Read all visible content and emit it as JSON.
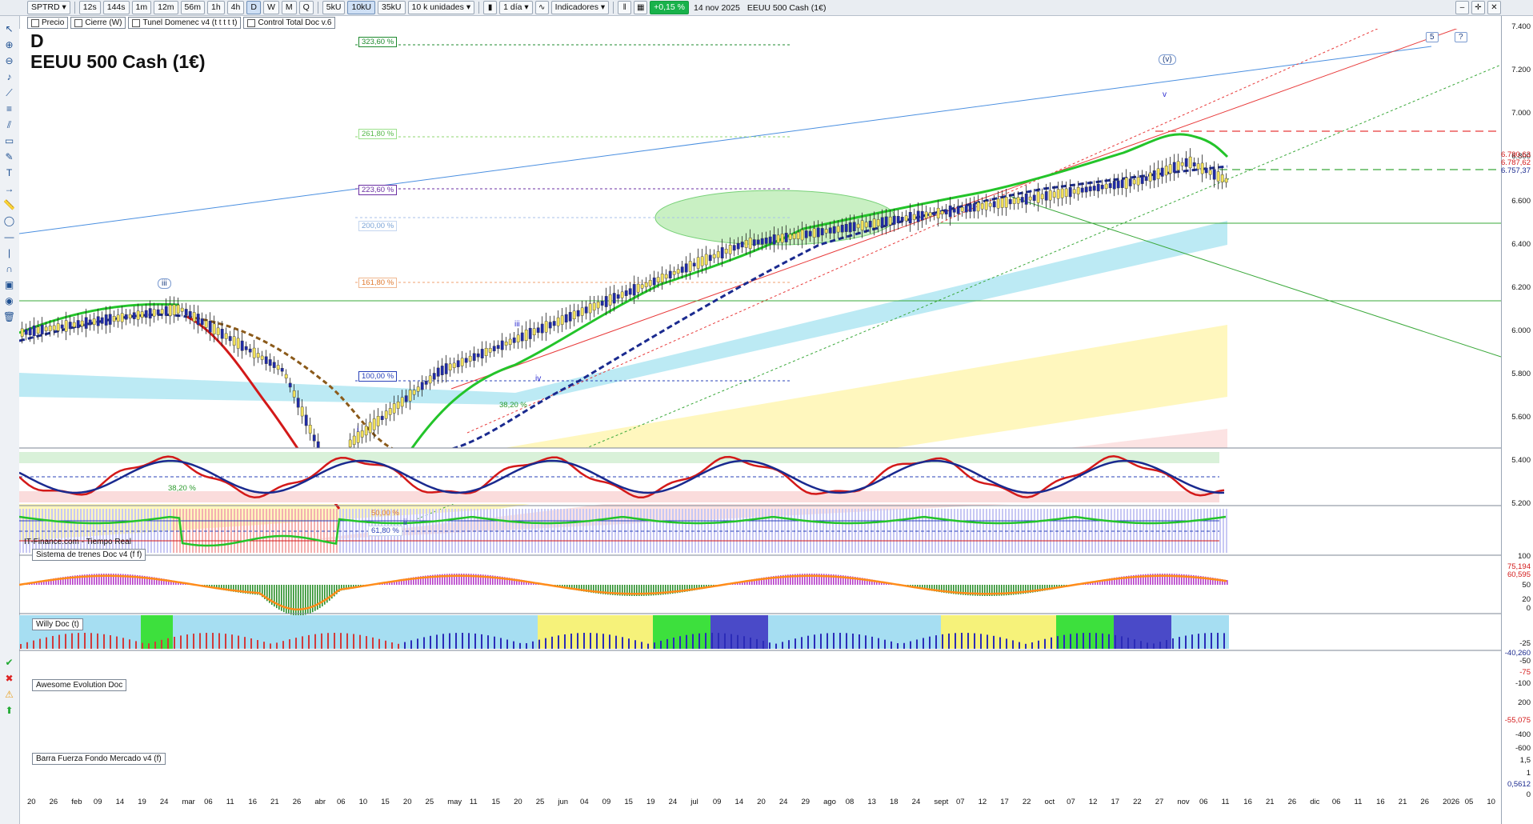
{
  "toolbar": {
    "symbol": "SPTRD",
    "intervals": [
      "12s",
      "144s",
      "1m",
      "12m",
      "56m",
      "1h",
      "4h",
      "D",
      "W",
      "M",
      "Q"
    ],
    "active_interval": "D",
    "volumes": [
      "5kU",
      "10kU",
      "35kU"
    ],
    "active_volume": "10kU",
    "units": "10 k unidades",
    "period": "1 día",
    "indicators_label": "Indicadores",
    "change": "+0,15 %",
    "date": "14 nov 2025",
    "instrument_title": "EEUU 500 Cash (1€)"
  },
  "overlays": [
    "Precio",
    "Cierre (W)",
    "Tunel Domenec v4 (t t t t t)",
    "Control Total Doc v.6"
  ],
  "chart": {
    "timeframe_letter": "D",
    "title": "EEUU 500 Cash (1€)",
    "source": "IT-Finance.com - Tiempo Real",
    "fib_levels": [
      {
        "label": "323,60 %",
        "color": "#1d8a2d"
      },
      {
        "label": "261,80 %",
        "color": "#55b84a"
      },
      {
        "label": "223,60 %",
        "color": "#6b2fa3"
      },
      {
        "label": "200,00 %",
        "color": "#7aa3d6"
      },
      {
        "label": "161,80 %",
        "color": "#e07a30"
      },
      {
        "label": "100,00 %",
        "color": "#2840b8"
      },
      {
        "label": "38,20 %",
        "color": "#2d9a2d"
      },
      {
        "label": "50,00 %",
        "color": "#e07a30"
      },
      {
        "label": "61,80 %",
        "color": "#2840b8"
      },
      {
        "label": "38,20 %",
        "color": "#2d9a2d"
      }
    ],
    "wave_labels": [
      "iii",
      "iii",
      "i",
      "ii",
      "iv",
      "v",
      "(v)",
      "5",
      "?"
    ]
  },
  "price_axis": {
    "labels": [
      "7.400",
      "7.200",
      "7.000",
      "6.800",
      "6.600",
      "6.400",
      "6.200",
      "6.000",
      "5.800",
      "5.600",
      "5.400",
      "5.200"
    ],
    "tags": [
      "6.790,63",
      "6.787,62",
      "6.757,37"
    ]
  },
  "subpanels": [
    {
      "title": "Sistema de trenes Doc v4 (f f)",
      "axis": [
        "100",
        "75,194",
        "60,595",
        "50",
        "20",
        "0"
      ]
    },
    {
      "title": "Willy Doc (t)",
      "axis": [
        "-25",
        "-40,260",
        "-50",
        "-75",
        "-100"
      ]
    },
    {
      "title": "Awesome Evolution Doc",
      "axis": [
        "200",
        "-55,075",
        "-400",
        "-600"
      ]
    },
    {
      "title": "Barra Fuerza Fondo Mercado v4 (f)",
      "axis": [
        "1,5",
        "1",
        "0,5612",
        "0"
      ]
    }
  ],
  "time_axis": [
    "20",
    "26",
    "feb",
    "09",
    "14",
    "19",
    "24",
    "mar",
    "06",
    "11",
    "16",
    "21",
    "26",
    "abr",
    "06",
    "10",
    "15",
    "20",
    "25",
    "may",
    "11",
    "15",
    "20",
    "25",
    "jun",
    "04",
    "09",
    "15",
    "19",
    "24",
    "jul",
    "09",
    "14",
    "20",
    "24",
    "29",
    "ago",
    "08",
    "13",
    "18",
    "24",
    "sept",
    "07",
    "12",
    "17",
    "22",
    "oct",
    "07",
    "12",
    "17",
    "22",
    "27",
    "nov",
    "06",
    "11",
    "16",
    "21",
    "26",
    "dic",
    "06",
    "11",
    "16",
    "21",
    "26",
    "2026",
    "05",
    "10"
  ],
  "colors": {
    "up_candle": "#f2e15a",
    "down_candle": "#1f2aa8",
    "ema_green": "#23c42a",
    "ema_red": "#d31919",
    "ema_blue": "#1a2a8f",
    "ema_brown": "#8b5a1a"
  }
}
